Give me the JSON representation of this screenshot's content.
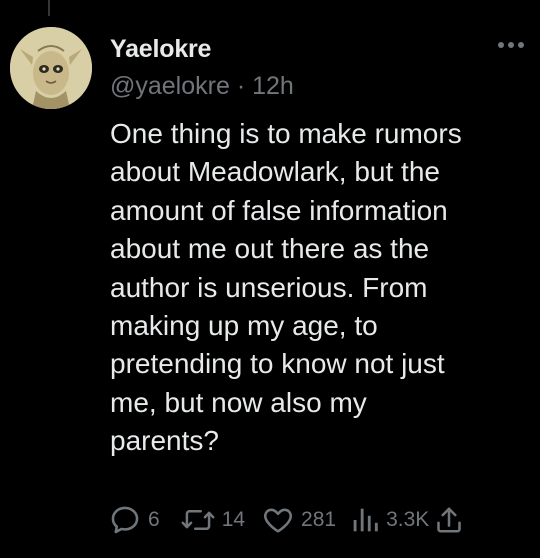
{
  "tweet": {
    "display_name": "Yaelokre",
    "handle": "@yaelokre",
    "separator": "·",
    "time": "12h",
    "body_lines": [
      "One thing is to make rumors",
      "about Meadowlark, but the",
      "amount of false information",
      "about me out there as the",
      "author is unserious. From",
      "making up my age, to",
      "pretending to know not just",
      "me, but now also my",
      "parents?"
    ],
    "stats": {
      "replies": "6",
      "retweets": "14",
      "likes": "281",
      "views": "3.3K"
    }
  },
  "icons": {
    "reply": "speech-bubble-icon",
    "retweet": "retweet-arrows-icon",
    "like": "heart-icon",
    "views": "bar-chart-icon",
    "share": "share-upload-icon",
    "more": "ellipsis-icon"
  },
  "colors": {
    "background": "#000000",
    "text_primary": "#e7e9ea",
    "text_secondary": "#71767b",
    "thread_line": "#333639"
  }
}
